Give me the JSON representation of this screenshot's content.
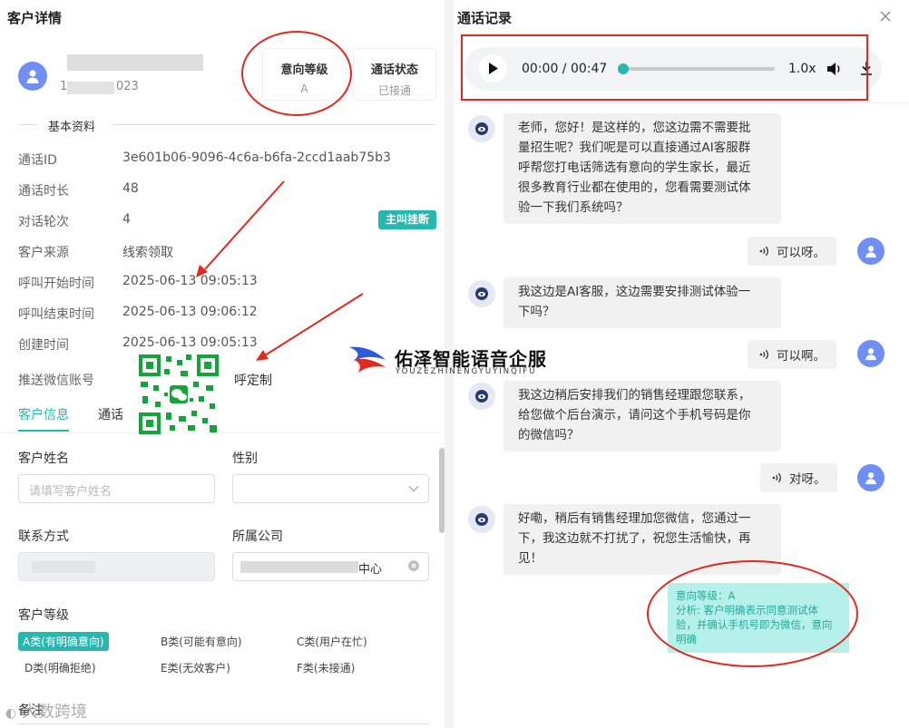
{
  "left_panel": {
    "title": "客户详情",
    "customer": {
      "name": "",
      "phone": "1",
      "phone_tail": "023"
    },
    "cards": [
      {
        "label": "意向等级",
        "value": "A"
      },
      {
        "label": "通话状态",
        "value": "已接通"
      }
    ],
    "section_basic": "基本资料",
    "fields": [
      {
        "label": "通话ID",
        "value": "3e601b06-9096-4c6a-b6fa-2ccd1aab75b3"
      },
      {
        "label": "通话时长",
        "value": "48"
      },
      {
        "label": "对话轮次",
        "value": "4"
      },
      {
        "label": "客户来源",
        "value": "线索领取"
      },
      {
        "label": "呼叫开始时间",
        "value": "2025-06-13 09:05:13"
      },
      {
        "label": "呼叫结束时间",
        "value": "2025-06-13 09:06:12"
      },
      {
        "label": "创建时间",
        "value": "2025-06-13 09:05:13"
      },
      {
        "label": "推送微信账号",
        "value": "呼定制"
      }
    ],
    "hangup_badge": "主叫挂断",
    "tabs": [
      "客户信息",
      "通话"
    ],
    "form": {
      "name_label": "客户姓名",
      "name_placeholder": "请填写客户姓名",
      "gender_label": "性别",
      "contact_label": "联系方式",
      "company_label": "所属公司",
      "company_value_tail": "中心",
      "level_label": "客户等级",
      "levels": [
        "A类(有明确意向)",
        "B类(可能有意向)",
        "C类(用户在忙)",
        "D类(明确拒绝)",
        "E类(无效客户)",
        "F类(未接通)"
      ],
      "remark_label": "备注"
    }
  },
  "right_panel": {
    "title": "通话记录",
    "player": {
      "time": "00:00 / 00:47",
      "speed": "1.0x",
      "progress": 0
    },
    "messages": [
      {
        "role": "bot",
        "lines": [
          "老师，您好！是这样的，您这边需不需要批",
          "量招生呢？我们呢是可以直接通过AI客服群",
          "呼帮您打电话筛选有意向的学生家长，最近",
          "很多教育行业都在使用的，您看需要测试体",
          "验一下我们系统吗？"
        ]
      },
      {
        "role": "user",
        "text": "可以呀。"
      },
      {
        "role": "bot",
        "lines": [
          "我这边是AI客服，这边需要安排测试体验一",
          "下吗？"
        ]
      },
      {
        "role": "user",
        "text": "可以啊。"
      },
      {
        "role": "bot",
        "lines": [
          "我这边稍后安排我们的销售经理跟您联系，",
          "给您做个后台演示，请问这个手机号码是你",
          "的微信吗？"
        ]
      },
      {
        "role": "user",
        "text": "对呀。"
      },
      {
        "role": "bot",
        "lines": [
          "好嘞，稍后有销售经理加您微信，您通过一",
          "下，我这边就不打扰了，祝您生活愉快，再",
          "见！"
        ]
      }
    ],
    "analysis": {
      "lines": [
        "意向等级：A",
        "分析: 客户明确表示同意测试体",
        "验，并确认手机号即为微信，意向",
        "明确"
      ]
    }
  },
  "overlay": {
    "brand": "佑泽智能语音企服",
    "brand_sub": "YOUZEZHINENGYUYINQIFU",
    "watermark": "大数跨境"
  },
  "colors": {
    "accent": "#26b8b0",
    "annotation": "#e0291f",
    "avatar": "#6f8ff5",
    "analysis_bg": "#b5f1ea"
  }
}
